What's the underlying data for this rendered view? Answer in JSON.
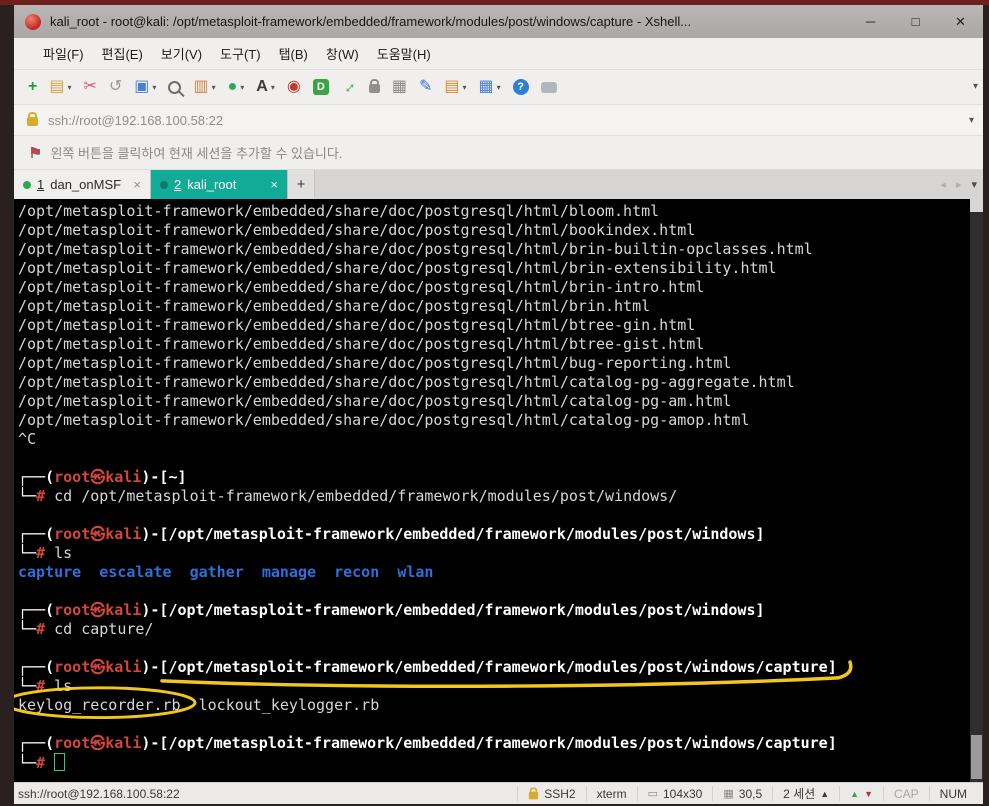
{
  "window": {
    "title": "kali_root - root@kali: /opt/metasploit-framework/embedded/framework/modules/post/windows/capture - Xshell...",
    "controls": {
      "minimize": "─",
      "maximize": "□",
      "close": "✕"
    }
  },
  "menubar": {
    "items": [
      "파일(F)",
      "편집(E)",
      "보기(V)",
      "도구(T)",
      "탭(B)",
      "창(W)",
      "도움말(H)"
    ]
  },
  "toolbar": {
    "overflow": "▾",
    "icons": [
      {
        "name": "new-session-icon",
        "kind": "glyph",
        "glyph": "+",
        "color": "#1f9d44",
        "bold": true,
        "dropdown": false
      },
      {
        "name": "open-session-icon",
        "kind": "glyph",
        "glyph": "▤",
        "color": "#d9a23c",
        "dropdown": true
      },
      {
        "name": "session-manager-icon",
        "kind": "glyph",
        "glyph": "✂",
        "color": "#d6527c",
        "dropdown": false
      },
      {
        "name": "reconnect-icon",
        "kind": "glyph",
        "glyph": "↺",
        "color": "#9a9a9a",
        "dropdown": false
      },
      {
        "name": "session-properties-icon",
        "kind": "glyph",
        "glyph": "▣",
        "color": "#4a7fd4",
        "dropdown": true
      },
      {
        "name": "find-icon",
        "kind": "search",
        "dropdown": false
      },
      {
        "name": "transfer-icon",
        "kind": "glyph",
        "glyph": "▥",
        "color": "#d9813c",
        "dropdown": true
      },
      {
        "name": "connect-icon",
        "kind": "glyph",
        "glyph": "●",
        "color": "#2fa84f",
        "dropdown": true
      },
      {
        "name": "font-icon",
        "kind": "glyph",
        "glyph": "A",
        "color": "#3b3b3b",
        "bold": true,
        "dropdown": true
      },
      {
        "name": "record-icon",
        "kind": "glyph",
        "glyph": "◉",
        "color": "#c43a31",
        "dropdown": false
      },
      {
        "name": "dynamic-forward-icon",
        "kind": "box",
        "glyph": "D",
        "color": "#ffffff",
        "bg": "#3aa546",
        "dropdown": false
      },
      {
        "name": "fullscreen-icon",
        "kind": "glyph",
        "glyph": "↔",
        "color": "#2fa84f",
        "bold": true,
        "rot": true,
        "dropdown": false
      },
      {
        "name": "lock-screen-icon",
        "kind": "lock",
        "dropdown": false
      },
      {
        "name": "calculator-icon",
        "kind": "glyph",
        "glyph": "▦",
        "color": "#8a8a8a",
        "dropdown": false
      },
      {
        "name": "compose-icon",
        "kind": "glyph",
        "glyph": "✎",
        "color": "#3a6fd8",
        "dropdown": false
      },
      {
        "name": "file-manager-icon",
        "kind": "glyph",
        "glyph": "▤",
        "color": "#e08a2e",
        "dropdown": true
      },
      {
        "name": "layout-icon",
        "kind": "glyph",
        "glyph": "▦",
        "color": "#4a7fd4",
        "dropdown": true
      },
      {
        "name": "help-icon",
        "kind": "box",
        "glyph": "?",
        "color": "#ffffff",
        "bg": "#2f7fd0",
        "round": true,
        "dropdown": false
      },
      {
        "name": "feedback-icon",
        "kind": "bubble",
        "dropdown": false
      }
    ]
  },
  "addressbar": {
    "value": "ssh://root@192.168.100.58:22",
    "dropdown": "▾"
  },
  "infobar": {
    "message": "왼쪽 버튼을 클릭하여 현재 세션을 추가할 수 있습니다."
  },
  "tabbar": {
    "tabs": [
      {
        "num": "1",
        "label": "dan_onMSF",
        "active": false,
        "close": "×"
      },
      {
        "num": "2",
        "label": "kali_root",
        "active": true,
        "close": "×"
      }
    ],
    "new_tab": "+",
    "nav_prev": "◂",
    "nav_next": "▸",
    "menu": "▾"
  },
  "terminal": {
    "lines": [
      [
        [
          "t",
          "/opt/metasploit-framework/embedded/share/doc/postgresql/html/bloom.html"
        ]
      ],
      [
        [
          "t",
          "/opt/metasploit-framework/embedded/share/doc/postgresql/html/bookindex.html"
        ]
      ],
      [
        [
          "t",
          "/opt/metasploit-framework/embedded/share/doc/postgresql/html/brin-builtin-opclasses.html"
        ]
      ],
      [
        [
          "t",
          "/opt/metasploit-framework/embedded/share/doc/postgresql/html/brin-extensibility.html"
        ]
      ],
      [
        [
          "t",
          "/opt/metasploit-framework/embedded/share/doc/postgresql/html/brin-intro.html"
        ]
      ],
      [
        [
          "t",
          "/opt/metasploit-framework/embedded/share/doc/postgresql/html/brin.html"
        ]
      ],
      [
        [
          "t",
          "/opt/metasploit-framework/embedded/share/doc/postgresql/html/btree-gin.html"
        ]
      ],
      [
        [
          "t",
          "/opt/metasploit-framework/embedded/share/doc/postgresql/html/btree-gist.html"
        ]
      ],
      [
        [
          "t",
          "/opt/metasploit-framework/embedded/share/doc/postgresql/html/bug-reporting.html"
        ]
      ],
      [
        [
          "t",
          "/opt/metasploit-framework/embedded/share/doc/postgresql/html/catalog-pg-aggregate.html"
        ]
      ],
      [
        [
          "t",
          "/opt/metasploit-framework/embedded/share/doc/postgresql/html/catalog-pg-am.html"
        ]
      ],
      [
        [
          "t",
          "/opt/metasploit-framework/embedded/share/doc/postgresql/html/catalog-pg-amop.html"
        ]
      ],
      [
        [
          "t",
          "^C"
        ]
      ],
      [],
      [
        [
          "p",
          "┌──("
        ],
        [
          "r",
          "root㉿kali"
        ],
        [
          "p",
          ")-["
        ],
        [
          "w",
          "~"
        ],
        [
          "p",
          "]"
        ]
      ],
      [
        [
          "p",
          "└─"
        ],
        [
          "r",
          "# "
        ],
        [
          "t",
          "cd /opt/metasploit-framework/embedded/framework/modules/post/windows/"
        ]
      ],
      [],
      [
        [
          "p",
          "┌──("
        ],
        [
          "r",
          "root㉿kali"
        ],
        [
          "p",
          ")-["
        ],
        [
          "w",
          "/opt/metasploit-framework/embedded/framework/modules/post/windows"
        ],
        [
          "p",
          "]"
        ]
      ],
      [
        [
          "p",
          "└─"
        ],
        [
          "r",
          "# "
        ],
        [
          "t",
          "ls"
        ]
      ],
      [
        [
          "u",
          "capture"
        ],
        [
          "t",
          "  "
        ],
        [
          "u",
          "escalate"
        ],
        [
          "t",
          "  "
        ],
        [
          "u",
          "gather"
        ],
        [
          "t",
          "  "
        ],
        [
          "u",
          "manage"
        ],
        [
          "t",
          "  "
        ],
        [
          "u",
          "recon"
        ],
        [
          "t",
          "  "
        ],
        [
          "u",
          "wlan"
        ]
      ],
      [],
      [
        [
          "p",
          "┌──("
        ],
        [
          "r",
          "root㉿kali"
        ],
        [
          "p",
          ")-["
        ],
        [
          "w",
          "/opt/metasploit-framework/embedded/framework/modules/post/windows"
        ],
        [
          "p",
          "]"
        ]
      ],
      [
        [
          "p",
          "└─"
        ],
        [
          "r",
          "# "
        ],
        [
          "t",
          "cd capture/"
        ]
      ],
      [],
      [
        [
          "p",
          "┌──("
        ],
        [
          "r",
          "root㉿kali"
        ],
        [
          "p",
          ")-["
        ],
        [
          "w",
          "/opt/metasploit-framework/embedded/framework/modules/post/windows/capture"
        ],
        [
          "p",
          "]"
        ]
      ],
      [
        [
          "p",
          "└─"
        ],
        [
          "r",
          "# "
        ],
        [
          "t",
          "ls"
        ]
      ],
      [
        [
          "t",
          "keylog_recorder.rb  lockout_keylogger.rb"
        ]
      ],
      [],
      [
        [
          "p",
          "┌──("
        ],
        [
          "r",
          "root㉿kali"
        ],
        [
          "p",
          ")-["
        ],
        [
          "w",
          "/opt/metasploit-framework/embedded/framework/modules/post/windows/capture"
        ],
        [
          "p",
          "]"
        ]
      ],
      [
        [
          "p",
          "└─"
        ],
        [
          "r",
          "# "
        ],
        [
          "cur",
          ""
        ]
      ]
    ]
  },
  "statusbar": {
    "left": "ssh://root@192.168.100.58:22",
    "items": [
      {
        "name": "status-protocol",
        "icon": "lock",
        "label": "SSH2"
      },
      {
        "name": "status-term-type",
        "label": "xterm"
      },
      {
        "name": "status-term-size",
        "icon": "size",
        "label": "104x30"
      },
      {
        "name": "status-cursor-pos",
        "icon": "pos",
        "label": "30,5"
      },
      {
        "name": "status-sessions",
        "label": "2 세션",
        "caret": "▲"
      },
      {
        "name": "status-traffic",
        "icon": "updown"
      },
      {
        "name": "status-caps-lock",
        "label": "CAP",
        "dim": true
      },
      {
        "name": "status-num-lock",
        "label": "NUM"
      }
    ]
  },
  "colors": {
    "active_tab": "#12ab97",
    "annotation_yellow": "#ffd21f",
    "prompt_red": "#d2473d",
    "directory_blue": "#2e6fd8",
    "terminal_bg": "#000000"
  }
}
